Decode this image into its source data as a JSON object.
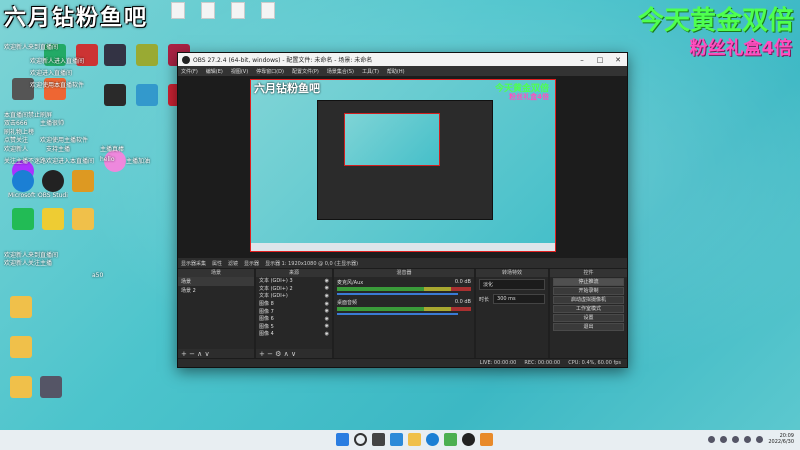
{
  "overlay": {
    "title_left": "六月钻粉鱼吧",
    "title_right": "今天黄金双倍",
    "subtitle_right": "粉丝礼盒4倍"
  },
  "desktop": {
    "top_files": [
      "",
      "",
      "",
      "",
      ""
    ],
    "side_texts": [
      "欢迎新人来到直播间",
      "欢迎新人进入直播间",
      "欢迎进入直播间",
      "欢迎使用本直播软件",
      "本直播间禁止刷屏",
      "双击666",
      "主播很帅",
      "刷礼物上榜",
      "点赞关注",
      "欢迎使用主播软件",
      "hello",
      "主播加油",
      "欢迎新人",
      "关注主播不迷路",
      "欢迎进入本直播间",
      "支持主播",
      "主播真棒",
      "a50"
    ],
    "bottom_texts": [
      "欢迎新人来到直播间",
      "欢迎新人关注主播"
    ],
    "icon_labels": [
      "Microsoft Edge",
      "OBS Studio",
      "",
      "",
      "",
      "",
      "",
      "",
      ""
    ]
  },
  "obs": {
    "title": "OBS 27.2.4 (64-bit, windows) - 配置文件: 未命名 - 场景: 未命名",
    "menu": [
      "文件(F)",
      "编辑(E)",
      "视图(V)",
      "停靠窗口(D)",
      "配置文件(P)",
      "场景集合(S)",
      "工具(T)",
      "帮助(H)"
    ],
    "canvas_overlay_green": "今天黄金双倍",
    "canvas_overlay_pink": "粉丝礼盒4倍",
    "canvas_overlay_left": "六月钻粉鱼吧",
    "toolbar": [
      "显示器采集",
      "属性",
      "滤镜",
      "显示器",
      "显示器 1: 1920x1080 @ 0,0 (主显示器)"
    ],
    "docks": {
      "scenes_title": "场景",
      "sources_title": "来源",
      "mixer_title": "混音器",
      "transitions_title": "转场特效",
      "controls_title": "控件"
    },
    "scenes": [
      "场景",
      "场景 2"
    ],
    "sources": [
      "文本 (GDI+) 3",
      "文本 (GDI+) 2",
      "文本 (GDI+)",
      "图像 8",
      "图像 7",
      "图像 6",
      "图像 5",
      "图像 4",
      "图像 3",
      "图像 2"
    ],
    "mixer": [
      {
        "name": "桌面音频",
        "db": "0.0 dB"
      },
      {
        "name": "麦克风/Aux",
        "db": "0.0 dB"
      }
    ],
    "transition": {
      "type": "淡化",
      "duration_label": "时长",
      "duration": "300 ms"
    },
    "controls": [
      "停止推流",
      "开始录制",
      "启动虚拟摄像机",
      "工作室模式",
      "设置",
      "退出"
    ],
    "status": [
      "LIVE: 00:00:00",
      "REC: 00:00:00",
      "CPU: 0.4%, 60.00 fps"
    ]
  },
  "taskbar": {
    "time": "20:09",
    "date": "2022/6/30"
  }
}
